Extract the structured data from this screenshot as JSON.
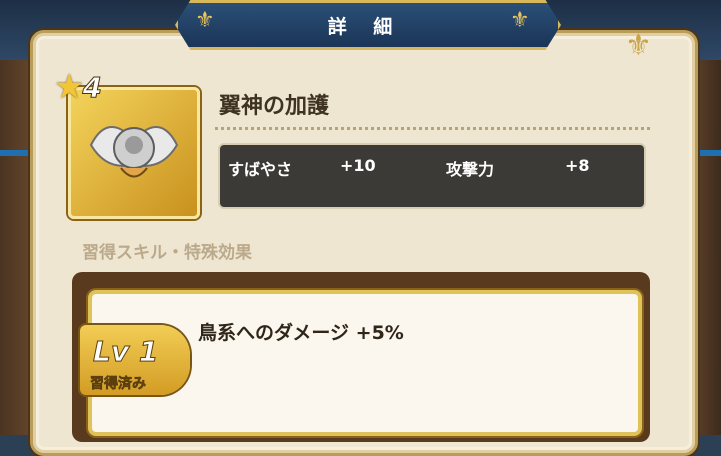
{
  "header": {
    "title": "詳 細"
  },
  "item": {
    "rarity": "4",
    "name": "翼神の加護",
    "icon": "winged-emblem-icon"
  },
  "stats": [
    {
      "label": "すばやさ",
      "value": "+10"
    },
    {
      "label": "攻撃力",
      "value": "+8"
    }
  ],
  "skills_section": {
    "label": "習得スキル・特殊効果",
    "skill": {
      "level": "Lv 1",
      "status": "習得済み",
      "description": "鳥系へのダメージ +5%"
    }
  },
  "colors": {
    "header_bg": "#1a3557",
    "gold": "#d8b85a",
    "panel_bg": "#efe6d1",
    "stats_bg": "#3b3a36"
  }
}
